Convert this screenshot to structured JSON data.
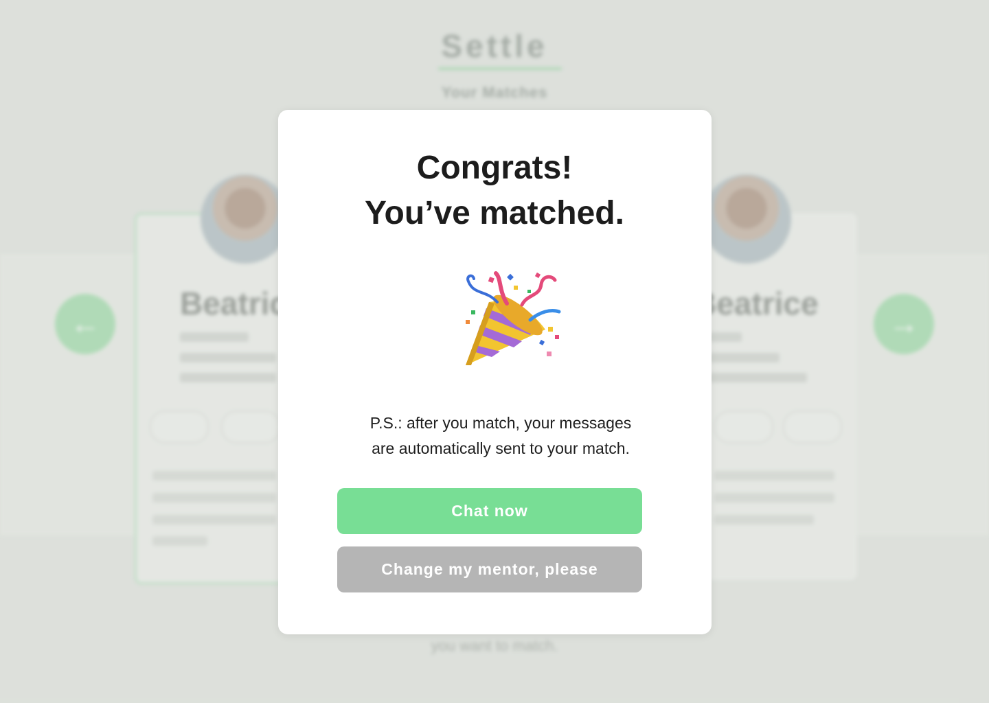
{
  "app": {
    "brand": "Settle",
    "subtitle": "Your Matches"
  },
  "background": {
    "cards": [
      {
        "name": "Beatrice"
      },
      {
        "name": "Beatrice"
      }
    ],
    "hint": "you want to match."
  },
  "modal": {
    "title_line1": "Congrats!",
    "title_line2": "You’ve matched.",
    "emoji_icon": "party-popper-icon",
    "note_line1": "P.S.: after you match, your messages",
    "note_line2": "are automatically sent to your match.",
    "primary_button": "Chat now",
    "secondary_button": "Change my mentor, please"
  },
  "colors": {
    "accent_green": "#78de95",
    "secondary_gray": "#b5b5b5"
  }
}
